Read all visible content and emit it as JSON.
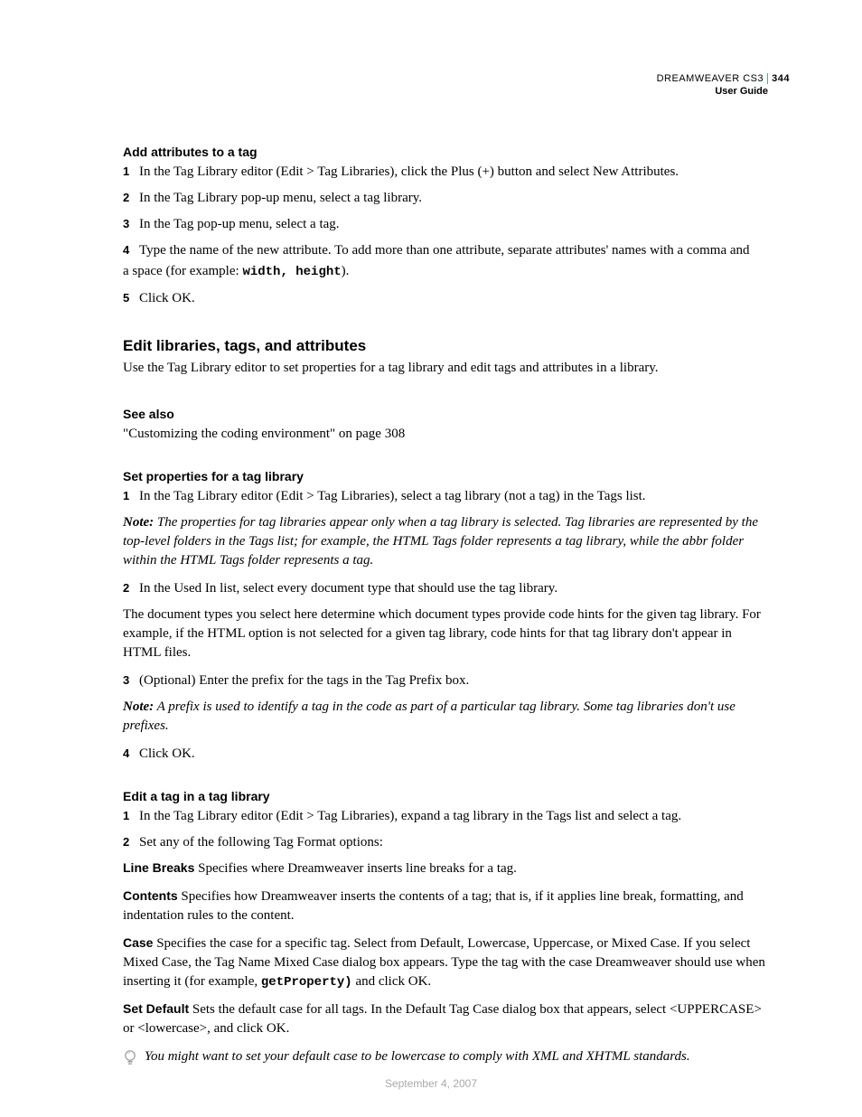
{
  "header": {
    "product": "DREAMWEAVER CS3",
    "page": "344",
    "guide": "User Guide"
  },
  "s1": {
    "title": "Add attributes to a tag",
    "step1": "In the Tag Library editor (Edit > Tag Libraries), click the Plus (+) button and select New Attributes.",
    "step2": "In the Tag Library pop-up menu, select a tag library.",
    "step3": "In the Tag pop-up menu, select a tag.",
    "step4a": "Type the name of the new attribute. To add more than one attribute, separate attributes' names with a comma and",
    "step4b_pre": "a space (for example: ",
    "step4b_code": "width, height",
    "step4b_post": ").",
    "step5": "Click OK."
  },
  "s2": {
    "title": "Edit libraries, tags, and attributes",
    "intro": "Use the Tag Library editor to set properties for a tag library and edit tags and attributes in a library."
  },
  "seealso": {
    "title": "See also",
    "link": "\"Customizing the coding environment\" on page 308"
  },
  "s3": {
    "title": "Set properties for a tag library",
    "step1": "In the Tag Library editor (Edit > Tag Libraries), select a tag library (not a tag) in the Tags list.",
    "note1_label": "Note:",
    "note1": " The properties for tag libraries appear only when a tag library is selected. Tag libraries are represented by the top-level folders in the Tags list; for example, the HTML Tags folder represents a tag library, while the abbr folder within the HTML Tags folder represents a tag.",
    "step2": "In the Used In list, select every document type that should use the tag library.",
    "para2": "The document types you select here determine which document types provide code hints for the given tag library. For example, if the HTML option is not selected for a given tag library, code hints for that tag library don't appear in HTML files.",
    "step3": "(Optional) Enter the prefix for the tags in the Tag Prefix box.",
    "note2_label": "Note:",
    "note2": " A prefix is used to identify a tag in the code as part of a particular tag library. Some tag libraries don't use prefixes.",
    "step4": "Click OK."
  },
  "s4": {
    "title": "Edit a tag in a tag library",
    "step1": "In the Tag Library editor (Edit > Tag Libraries), expand a tag library in the Tags list and select a tag.",
    "step2": "Set any of the following Tag Format options:",
    "d1t": "Line Breaks",
    "d1": "  Specifies where Dreamweaver inserts line breaks for a tag.",
    "d2t": "Contents",
    "d2": "  Specifies how Dreamweaver inserts the contents of a tag; that is, if it applies line break, formatting, and indentation rules to the content.",
    "d3t": "Case",
    "d3a": "  Specifies the case for a specific tag. Select from Default, Lowercase, Uppercase, or Mixed Case. If you select Mixed Case, the Tag Name Mixed Case dialog box appears. Type the tag with the case Dreamweaver should use when inserting it (for example, ",
    "d3code": "getProperty)",
    "d3b": "  and click OK.",
    "d4t": "Set Default",
    "d4": "  Sets the default case for all tags. In the Default Tag Case dialog box that appears, select <UPPERCASE> or <lowercase>, and click OK.",
    "tip": "You might want to set your default case to be lowercase to comply with XML and XHTML standards."
  },
  "footer": "September 4, 2007"
}
